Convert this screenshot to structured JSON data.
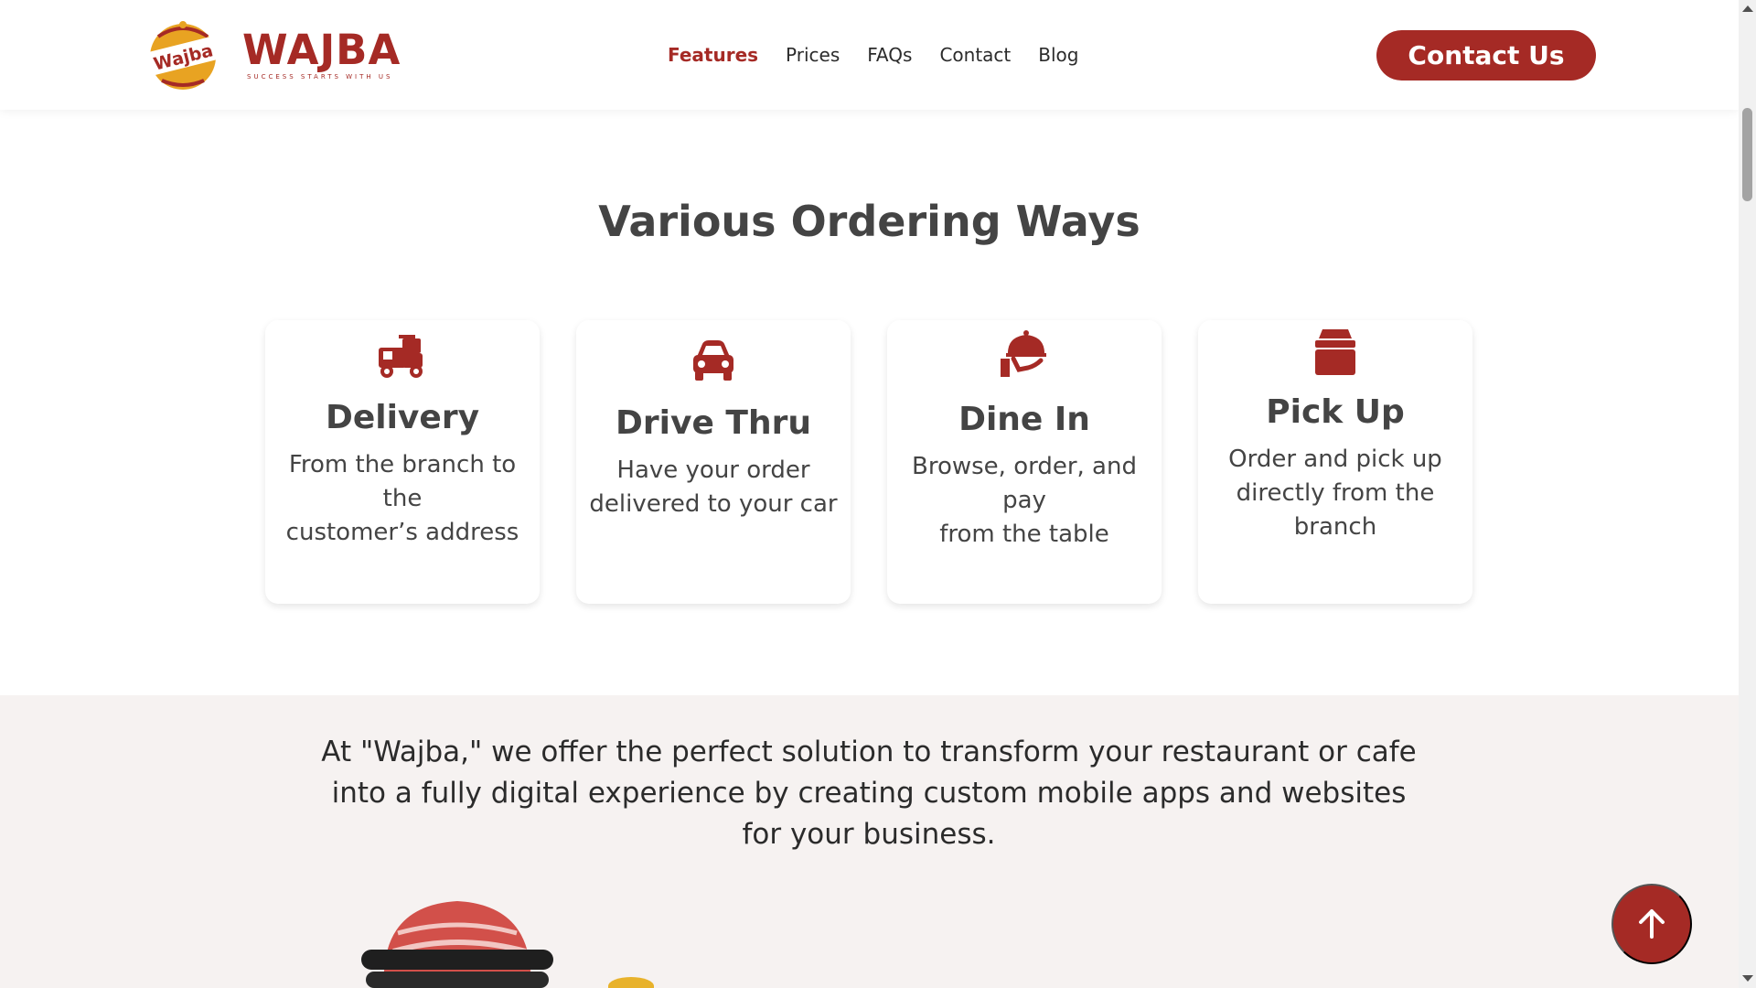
{
  "brand": {
    "name": "WAJBA",
    "tagline": "SUCCESS STARTS WITH US",
    "badge_text": "Wajba",
    "accent": "#a52a25",
    "badge_color": "#e8a322"
  },
  "nav": {
    "items": [
      {
        "label": "Features",
        "active": true
      },
      {
        "label": "Prices",
        "active": false
      },
      {
        "label": "FAQs",
        "active": false
      },
      {
        "label": "Contact",
        "active": false
      },
      {
        "label": "Blog",
        "active": false
      }
    ]
  },
  "header": {
    "cta_label": "Contact Us"
  },
  "section": {
    "title": "Various Ordering Ways",
    "cards": [
      {
        "icon": "delivery-truck-icon",
        "title": "Delivery",
        "text_lines": [
          "From the branch to the",
          "customer’s address"
        ]
      },
      {
        "icon": "car-icon",
        "title": "Drive Thru",
        "text_lines": [
          "Have your order",
          "delivered to your car"
        ]
      },
      {
        "icon": "cloche-serving-icon",
        "title": "Dine In",
        "text_lines": [
          "Browse, order, and pay",
          "from the table"
        ]
      },
      {
        "icon": "box-icon",
        "title": "Pick Up",
        "text_lines": [
          "Order and pick up",
          "directly from the",
          "branch"
        ]
      }
    ]
  },
  "band": {
    "lines": [
      "At \"Wajba,\" we offer the perfect solution to transform your restaurant or cafe",
      "into a fully digital experience by creating custom mobile apps and websites",
      "for your business."
    ],
    "background": "#f6f2f1"
  },
  "scroll_to_top": {
    "icon": "arrow-up-icon"
  }
}
